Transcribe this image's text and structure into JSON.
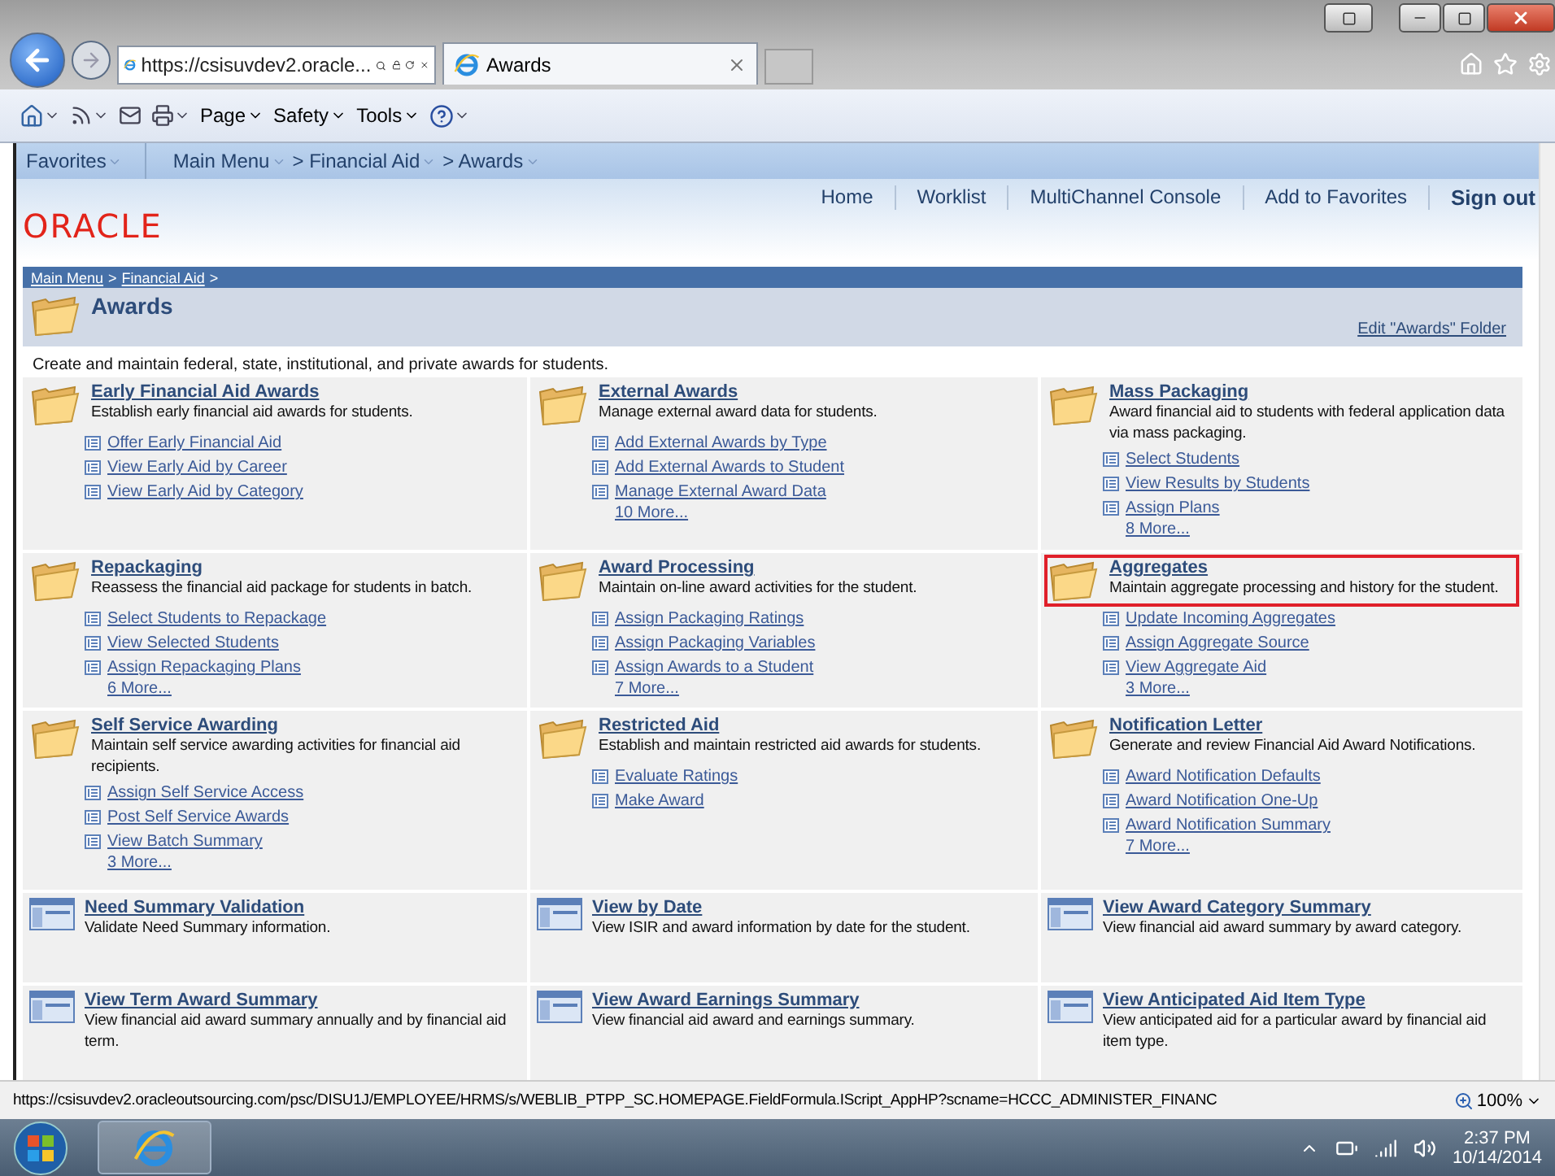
{
  "browser": {
    "address": "https://csisuvdev2.oracle...",
    "tab": "Awards",
    "command_bar": [
      "Page",
      "Safety",
      "Tools"
    ]
  },
  "portal": {
    "menu": [
      "Favorites",
      "Main Menu",
      "> Financial Aid",
      "> Awards"
    ],
    "links": [
      "Home",
      "Worklist",
      "MultiChannel Console",
      "Add to Favorites",
      "Sign out"
    ],
    "logo": "ORACLE"
  },
  "breadcrumb": {
    "links": [
      "Main Menu",
      "Financial Aid"
    ],
    "separator": ">"
  },
  "page": {
    "title": "Awards",
    "edit_link": "Edit \"Awards\" Folder",
    "description": "Create and maintain federal, state, institutional, and private awards for students."
  },
  "cells": [
    {
      "kind": "folder",
      "title": "Early Financial Aid Awards",
      "description": "Establish early financial aid awards for students.",
      "highlighted": false,
      "items": [
        "Offer Early Financial Aid",
        "View Early Aid by Career",
        "View Early Aid by Category"
      ]
    },
    {
      "kind": "folder",
      "title": "External Awards",
      "description": "Manage external award data for students.",
      "highlighted": false,
      "items": [
        "Add External Awards by Type",
        "Add External Awards to Student",
        "Manage External Award Data"
      ],
      "more": "10 More..."
    },
    {
      "kind": "folder",
      "title": "Mass Packaging",
      "description": "Award financial aid to students with federal application data via mass packaging.",
      "highlighted": false,
      "items": [
        "Select Students",
        "View Results by Students",
        "Assign Plans"
      ],
      "more": "8 More..."
    },
    {
      "kind": "folder",
      "title": "Repackaging",
      "description": "Reassess the financial aid package for students in batch.",
      "highlighted": false,
      "items": [
        "Select Students to Repackage",
        "View Selected Students",
        "Assign Repackaging Plans"
      ],
      "more": "6 More..."
    },
    {
      "kind": "folder",
      "title": "Award Processing",
      "description": "Maintain on-line award activities for the student.",
      "highlighted": false,
      "items": [
        "Assign Packaging Ratings",
        "Assign Packaging Variables",
        "Assign Awards to a Student"
      ],
      "more": "7 More..."
    },
    {
      "kind": "folder",
      "title": "Aggregates",
      "description": "Maintain aggregate processing and history for the student.",
      "highlighted": true,
      "items": [
        "Update Incoming Aggregates",
        "Assign Aggregate Source",
        "View Aggregate Aid"
      ],
      "more": "3 More..."
    },
    {
      "kind": "folder",
      "title": "Self Service Awarding",
      "description": "Maintain self service awarding activities for financial aid recipients.",
      "highlighted": false,
      "items": [
        "Assign Self Service Access",
        "Post Self Service Awards",
        "View Batch Summary"
      ],
      "more": "3 More..."
    },
    {
      "kind": "folder",
      "title": "Restricted Aid",
      "description": "Establish and maintain restricted aid awards for students.",
      "highlighted": false,
      "items": [
        "Evaluate Ratings",
        "Make Award"
      ]
    },
    {
      "kind": "folder",
      "title": "Notification Letter",
      "description": "Generate and review Financial Aid Award Notifications.",
      "highlighted": false,
      "items": [
        "Award Notification Defaults",
        "Award Notification One-Up",
        "Award Notification Summary"
      ],
      "more": "7 More..."
    },
    {
      "kind": "page",
      "title": "Need Summary Validation",
      "description": "Validate Need Summary information.",
      "highlighted": false
    },
    {
      "kind": "page",
      "title": "View by Date",
      "description": "View ISIR and award information by date for the student.",
      "highlighted": false
    },
    {
      "kind": "page",
      "title": "View Award Category Summary",
      "description": "View financial aid award summary by award category.",
      "highlighted": false
    },
    {
      "kind": "page",
      "title": "View Term Award Summary",
      "description": "View financial aid award summary annually and by financial aid term.",
      "highlighted": false
    },
    {
      "kind": "page",
      "title": "View Award Earnings Summary",
      "description": "View financial aid award and earnings summary.",
      "highlighted": false
    },
    {
      "kind": "page",
      "title": "View Anticipated Aid Item Type",
      "description": "View anticipated aid for a particular award by financial aid item type.",
      "highlighted": false
    }
  ],
  "status_bar": {
    "url": "https://csisuvdev2.oracleoutsourcing.com/psc/DISU1J/EMPLOYEE/HRMS/s/WEBLIB_PTPP_SC.HOMEPAGE.FieldFormula.IScript_AppHP?scname=HCCC_ADMINISTER_FINANC",
    "zoom": "100%"
  },
  "taskbar": {
    "time": "2:37 PM",
    "date": "10/14/2014"
  }
}
